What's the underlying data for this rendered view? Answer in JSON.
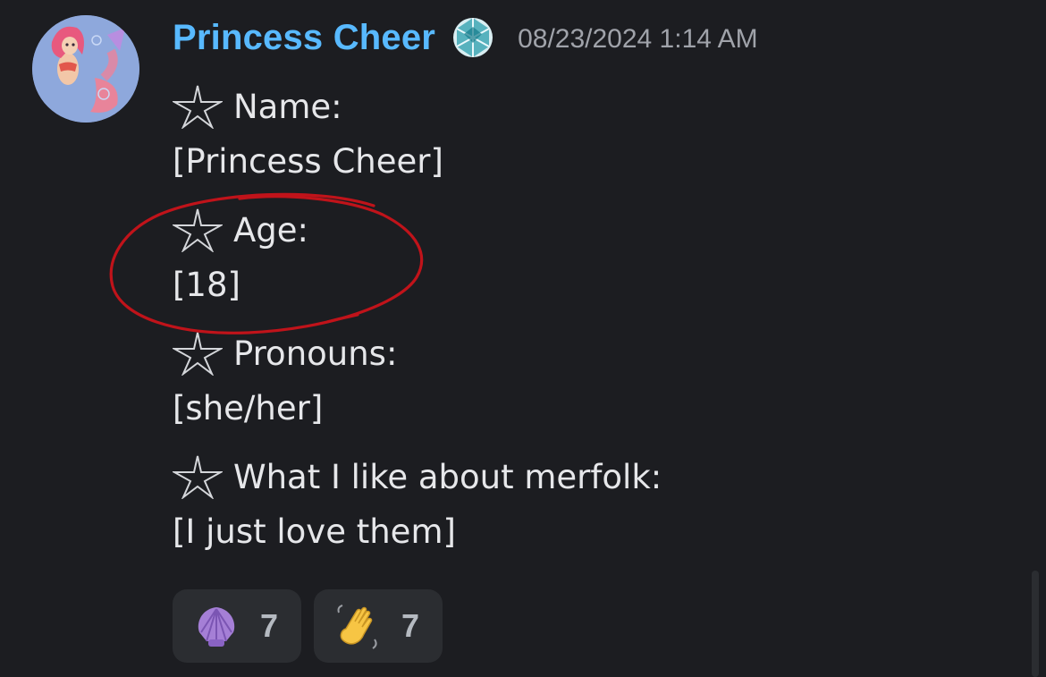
{
  "message": {
    "author": "Princess Cheer",
    "timestamp": "08/23/2024 1:14 AM",
    "author_color": "#58b9ff",
    "avatar_icon": "mermaid-avatar",
    "badge_icon": "crystal-badge-icon",
    "fields": [
      {
        "label": "Name:",
        "value": "[Princess Cheer]"
      },
      {
        "label": "Age:",
        "value": "[18]"
      },
      {
        "label": "Pronouns:",
        "value": "[she/her]"
      },
      {
        "label": "What I like about merfolk:",
        "value": "[I just love them]"
      }
    ],
    "field_icon": "starfish-icon",
    "annotation_color": "#c0131a",
    "reactions": [
      {
        "emoji": "shell-icon",
        "count": "7"
      },
      {
        "emoji": "waving-hand-icon",
        "count": "7"
      }
    ]
  }
}
